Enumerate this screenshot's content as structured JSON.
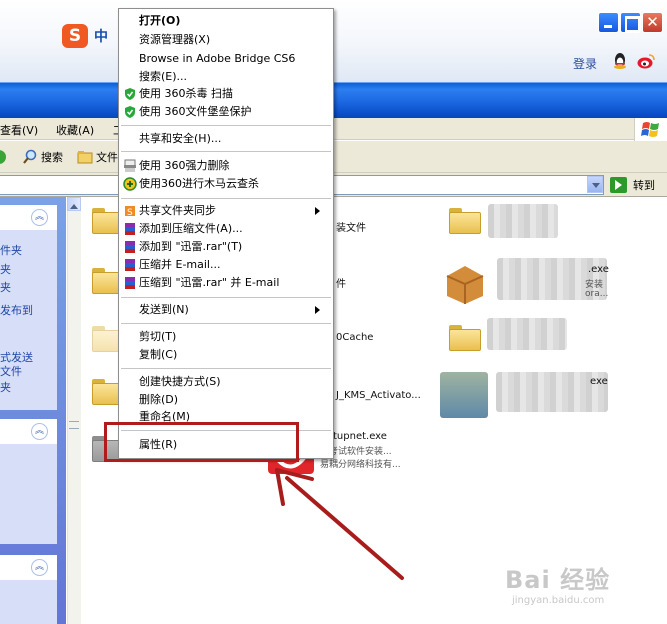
{
  "topbar": {
    "ime_logo": "S",
    "ime_mode": "中",
    "login": "登录"
  },
  "menubar": {
    "items": [
      "查看(V)",
      "收藏(A)",
      "工"
    ]
  },
  "toolbar": {
    "search": "搜索",
    "folders": "文件"
  },
  "addressbar": {
    "go": "转到"
  },
  "taskpane": {
    "box1_links": [
      "件夹",
      "夹",
      "夹",
      "发布到"
    ],
    "box1_link2": [
      "式发送",
      "文件",
      "夹"
    ],
    "toggle": "︽"
  },
  "files": {
    "left_names": [
      "装文件",
      "件",
      "0Cache",
      "J_KMS_Activato..."
    ],
    "setup_name": "tupnet.exe",
    "setup_desc1": "川考试软件安装...",
    "setup_desc2": "易耦分网络科技有...",
    "right_exe1": ".exe",
    "right_exe1_sub1": "安装",
    "right_exe1_sub2": "ora...",
    "right_exe2": "exe"
  },
  "context_menu": {
    "items": [
      {
        "label": "打开(O)",
        "bold": true
      },
      {
        "label": "资源管理器(X)"
      },
      {
        "label": "Browse in Adobe Bridge CS6"
      },
      {
        "label": "搜索(E)..."
      },
      {
        "label": "使用 360杀毒 扫描",
        "icon": "shield-360-icon"
      },
      {
        "label": "使用 360文件堡垒保护",
        "icon": "shield-360-icon"
      },
      {
        "label": "共享和安全(H)..."
      },
      {
        "label": "使用 360强力删除",
        "icon": "shredder-icon"
      },
      {
        "label": "使用360进行木马云查杀",
        "icon": "cloud-scan-icon"
      },
      {
        "label": "共享文件夹同步",
        "icon": "sync-icon",
        "submenu": true
      },
      {
        "label": "添加到压缩文件(A)...",
        "icon": "winrar-icon"
      },
      {
        "label": "添加到 \"迅雷.rar\"(T)",
        "icon": "winrar-icon"
      },
      {
        "label": "压缩并 E-mail...",
        "icon": "winrar-icon"
      },
      {
        "label": "压缩到 \"迅雷.rar\" 并 E-mail",
        "icon": "winrar-icon"
      },
      {
        "label": "发送到(N)",
        "submenu": true
      },
      {
        "label": "剪切(T)"
      },
      {
        "label": "复制(C)"
      },
      {
        "label": "创建快捷方式(S)"
      },
      {
        "label": "删除(D)"
      },
      {
        "label": "重命名(M)"
      },
      {
        "label": "属性(R)"
      }
    ]
  },
  "watermark": {
    "brand": "Bai 经验",
    "url": "jingyan.baidu.com"
  },
  "colors": {
    "annotation": "#b01c1c",
    "titlebar": "#0b51cc",
    "link": "#2146a8"
  }
}
